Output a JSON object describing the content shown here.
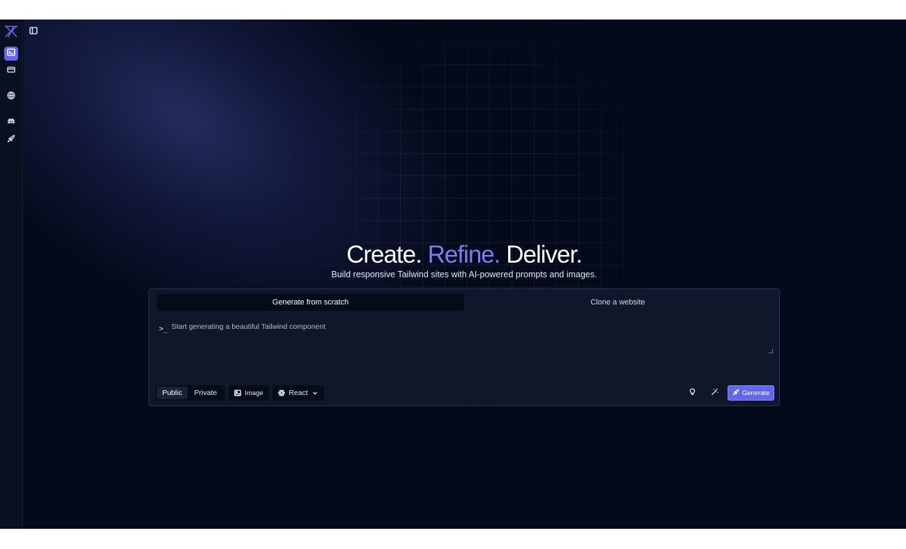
{
  "rail": {
    "items": [
      {
        "name": "generator",
        "icon": "terminal-window-icon",
        "active": true
      },
      {
        "name": "components",
        "icon": "card-icon",
        "active": false
      },
      {
        "name": "explore",
        "icon": "globe-icon",
        "active": false
      },
      {
        "name": "discord",
        "icon": "discord-icon",
        "active": false
      },
      {
        "name": "launch",
        "icon": "rocket-icon",
        "active": false
      }
    ]
  },
  "hero": {
    "title_part1": "Create.",
    "title_accent": "Refine.",
    "title_part2": "Deliver.",
    "subtitle": "Build responsive Tailwind sites with AI-powered prompts and images."
  },
  "tabs": {
    "scratch": "Generate from scratch",
    "clone": "Clone a website",
    "active": "scratch"
  },
  "prompt": {
    "prefix": ">_",
    "placeholder": "Start generating a beautiful Tailwind component",
    "value": ""
  },
  "controls": {
    "visibility_public": "Public",
    "visibility_private": "Private",
    "visibility_selected": "Public",
    "image_label": "Image",
    "framework_selected": "React",
    "generate_label": "Generate"
  },
  "colors": {
    "accent": "#6366f1",
    "accent_text": "#7c7ef2",
    "background": "#050a1a",
    "panel": "#10172a"
  }
}
